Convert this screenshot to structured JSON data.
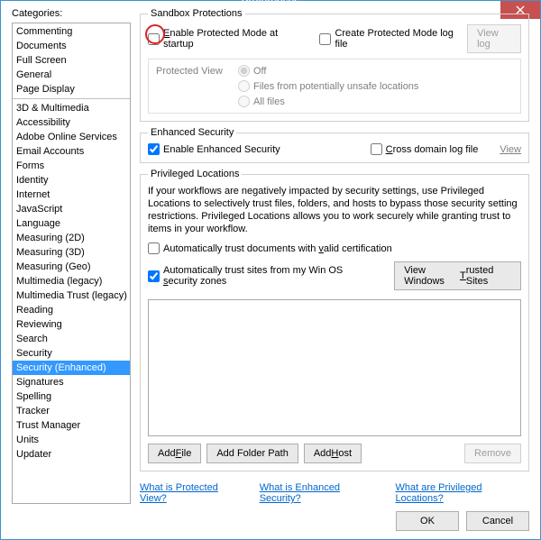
{
  "title": "Preferences",
  "categories_heading": "Categories:",
  "categories_group1": [
    "Commenting",
    "Documents",
    "Full Screen",
    "General",
    "Page Display"
  ],
  "categories_group2": [
    "3D & Multimedia",
    "Accessibility",
    "Adobe Online Services",
    "Email Accounts",
    "Forms",
    "Identity",
    "Internet",
    "JavaScript",
    "Language",
    "Measuring (2D)",
    "Measuring (3D)",
    "Measuring (Geo)",
    "Multimedia (legacy)",
    "Multimedia Trust (legacy)",
    "Reading",
    "Reviewing",
    "Search",
    "Security",
    "Security (Enhanced)",
    "Signatures",
    "Spelling",
    "Tracker",
    "Trust Manager",
    "Units",
    "Updater"
  ],
  "selected_category": "Security (Enhanced)",
  "sandbox": {
    "legend": "Sandbox Protections",
    "enable_protected_label": "Enable Protected Mode at startup",
    "enable_protected_u": "E",
    "create_log_label": "Create Protected Mode log file",
    "view_log_btn": "View log",
    "protected_view_label": "Protected View",
    "off": "Off",
    "unsafe": "Files from potentially unsafe locations",
    "all": "All files"
  },
  "enhanced": {
    "legend": "Enhanced Security",
    "enable_label": "Enable Enhanced Security",
    "cross_domain_label": "Cross domain log file",
    "cross_domain_u": "C",
    "view": "View"
  },
  "priv": {
    "legend": "Privileged Locations",
    "desc": "If your workflows are negatively impacted by security settings, use Privileged Locations to selectively trust files, folders, and hosts to bypass those security setting restrictions. Privileged Locations allows you to work securely while granting trust to items in your workflow.",
    "auto_docs_pre": "Automatically trust documents with ",
    "auto_docs_u": "v",
    "auto_docs_post": "alid certification",
    "auto_sites_pre": "Automatically trust sites from my Win OS ",
    "auto_sites_u": "s",
    "auto_sites_post": "ecurity zones",
    "view_trusted_pre": "View Windows ",
    "view_trusted_u": "T",
    "view_trusted_post": "rusted Sites",
    "add_file_pre": "Add ",
    "add_file_u": "F",
    "add_file_post": "ile",
    "add_folder": "Add Folder Path",
    "add_host_pre": "Add ",
    "add_host_u": "H",
    "add_host_post": "ost",
    "remove": "Remove"
  },
  "links": {
    "l1": "What is Protected View?",
    "l2": "What is Enhanced Security?",
    "l3": "What are Privileged Locations?"
  },
  "footer": {
    "ok": "OK",
    "cancel": "Cancel"
  }
}
